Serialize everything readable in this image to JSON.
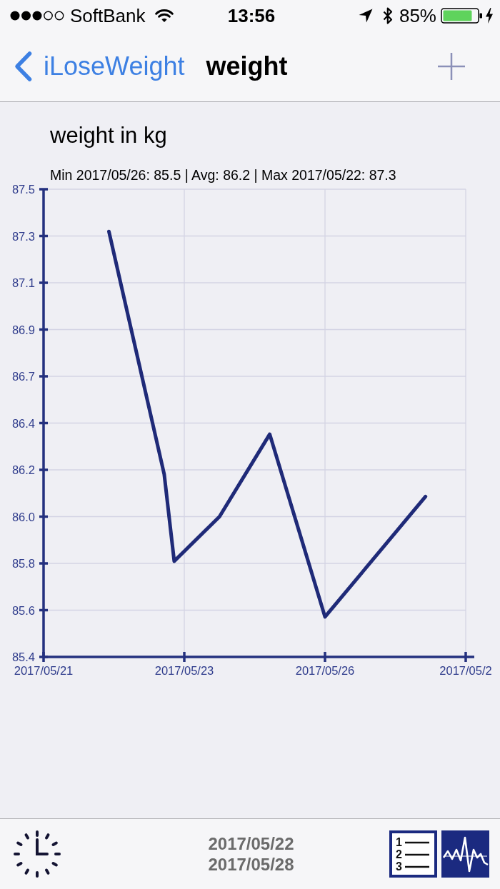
{
  "status_bar": {
    "carrier": "SoftBank",
    "time": "13:56",
    "battery": "85%"
  },
  "nav_bar": {
    "back": "iLoseWeight",
    "title": "weight"
  },
  "chart": {
    "summary": "Min 2017/05/26: 85.5 | Avg: 86.2 | Max 2017/05/22: 87.3",
    "chart_data": {
      "type": "line",
      "title": "weight in kg",
      "grid": true,
      "categories": [
        "2017/05/21",
        null,
        null,
        null,
        null,
        null,
        null,
        null,
        null,
        null,
        null,
        null,
        null,
        null,
        null,
        null,
        null,
        null,
        null,
        null,
        null,
        null,
        null,
        null,
        null,
        null,
        null,
        null,
        "2017/05/23",
        null,
        null,
        null,
        null,
        null,
        null,
        null,
        null,
        null,
        null,
        null,
        null,
        null,
        null,
        null,
        null,
        null,
        null,
        null,
        null,
        null,
        null,
        null,
        null,
        null,
        null,
        null,
        "2017/05/26",
        null,
        null,
        null,
        null,
        null,
        null,
        null,
        null,
        null,
        null,
        null,
        null,
        null,
        null,
        null,
        null,
        null,
        null,
        null,
        null,
        null,
        null,
        null,
        null,
        null,
        null,
        null,
        "2017/05/2"
      ],
      "series": [
        {
          "color": "#1f2a78",
          "values": [
            null,
            null,
            null,
            null,
            null,
            null,
            null,
            null,
            null,
            null,
            null,
            null,
            null,
            87.31,
            null,
            null,
            null,
            null,
            null,
            null,
            null,
            null,
            null,
            null,
            86.22,
            null,
            85.83,
            null,
            null,
            null,
            null,
            null,
            null,
            null,
            null,
            86.03,
            null,
            null,
            null,
            null,
            null,
            null,
            null,
            null,
            null,
            86.4,
            null,
            null,
            null,
            null,
            null,
            null,
            null,
            null,
            null,
            null,
            85.58,
            null,
            null,
            null,
            null,
            null,
            null,
            null,
            null,
            null,
            null,
            null,
            null,
            null,
            null,
            null,
            null,
            null,
            null,
            null,
            86.12,
            null,
            null,
            null,
            null,
            null,
            null,
            null,
            null
          ]
        }
      ],
      "ylim": [
        85.4,
        87.5
      ],
      "yticks": [
        {
          "value": 85.4,
          "label": "85.4"
        },
        {
          "value": 85.61,
          "label": "85.6"
        },
        {
          "value": 85.82,
          "label": "85.8"
        },
        {
          "value": 86.03,
          "label": "86.0"
        },
        {
          "value": 86.24,
          "label": "86.2"
        },
        {
          "value": 86.45,
          "label": "86.4"
        },
        {
          "value": 86.66,
          "label": "86.7"
        },
        {
          "value": 86.87,
          "label": "86.9"
        },
        {
          "value": 87.08,
          "label": "87.1"
        },
        {
          "value": 87.29,
          "label": "87.3"
        },
        {
          "value": 87.5,
          "label": "87.5"
        }
      ]
    }
  },
  "toolbar": {
    "date_range": [
      "2017/05/22",
      "2017/05/28"
    ],
    "views": [
      {
        "kind": "list",
        "selected": false,
        "numbers": [
          "1",
          "2",
          "3"
        ]
      },
      {
        "kind": "chart",
        "selected": true
      }
    ]
  }
}
